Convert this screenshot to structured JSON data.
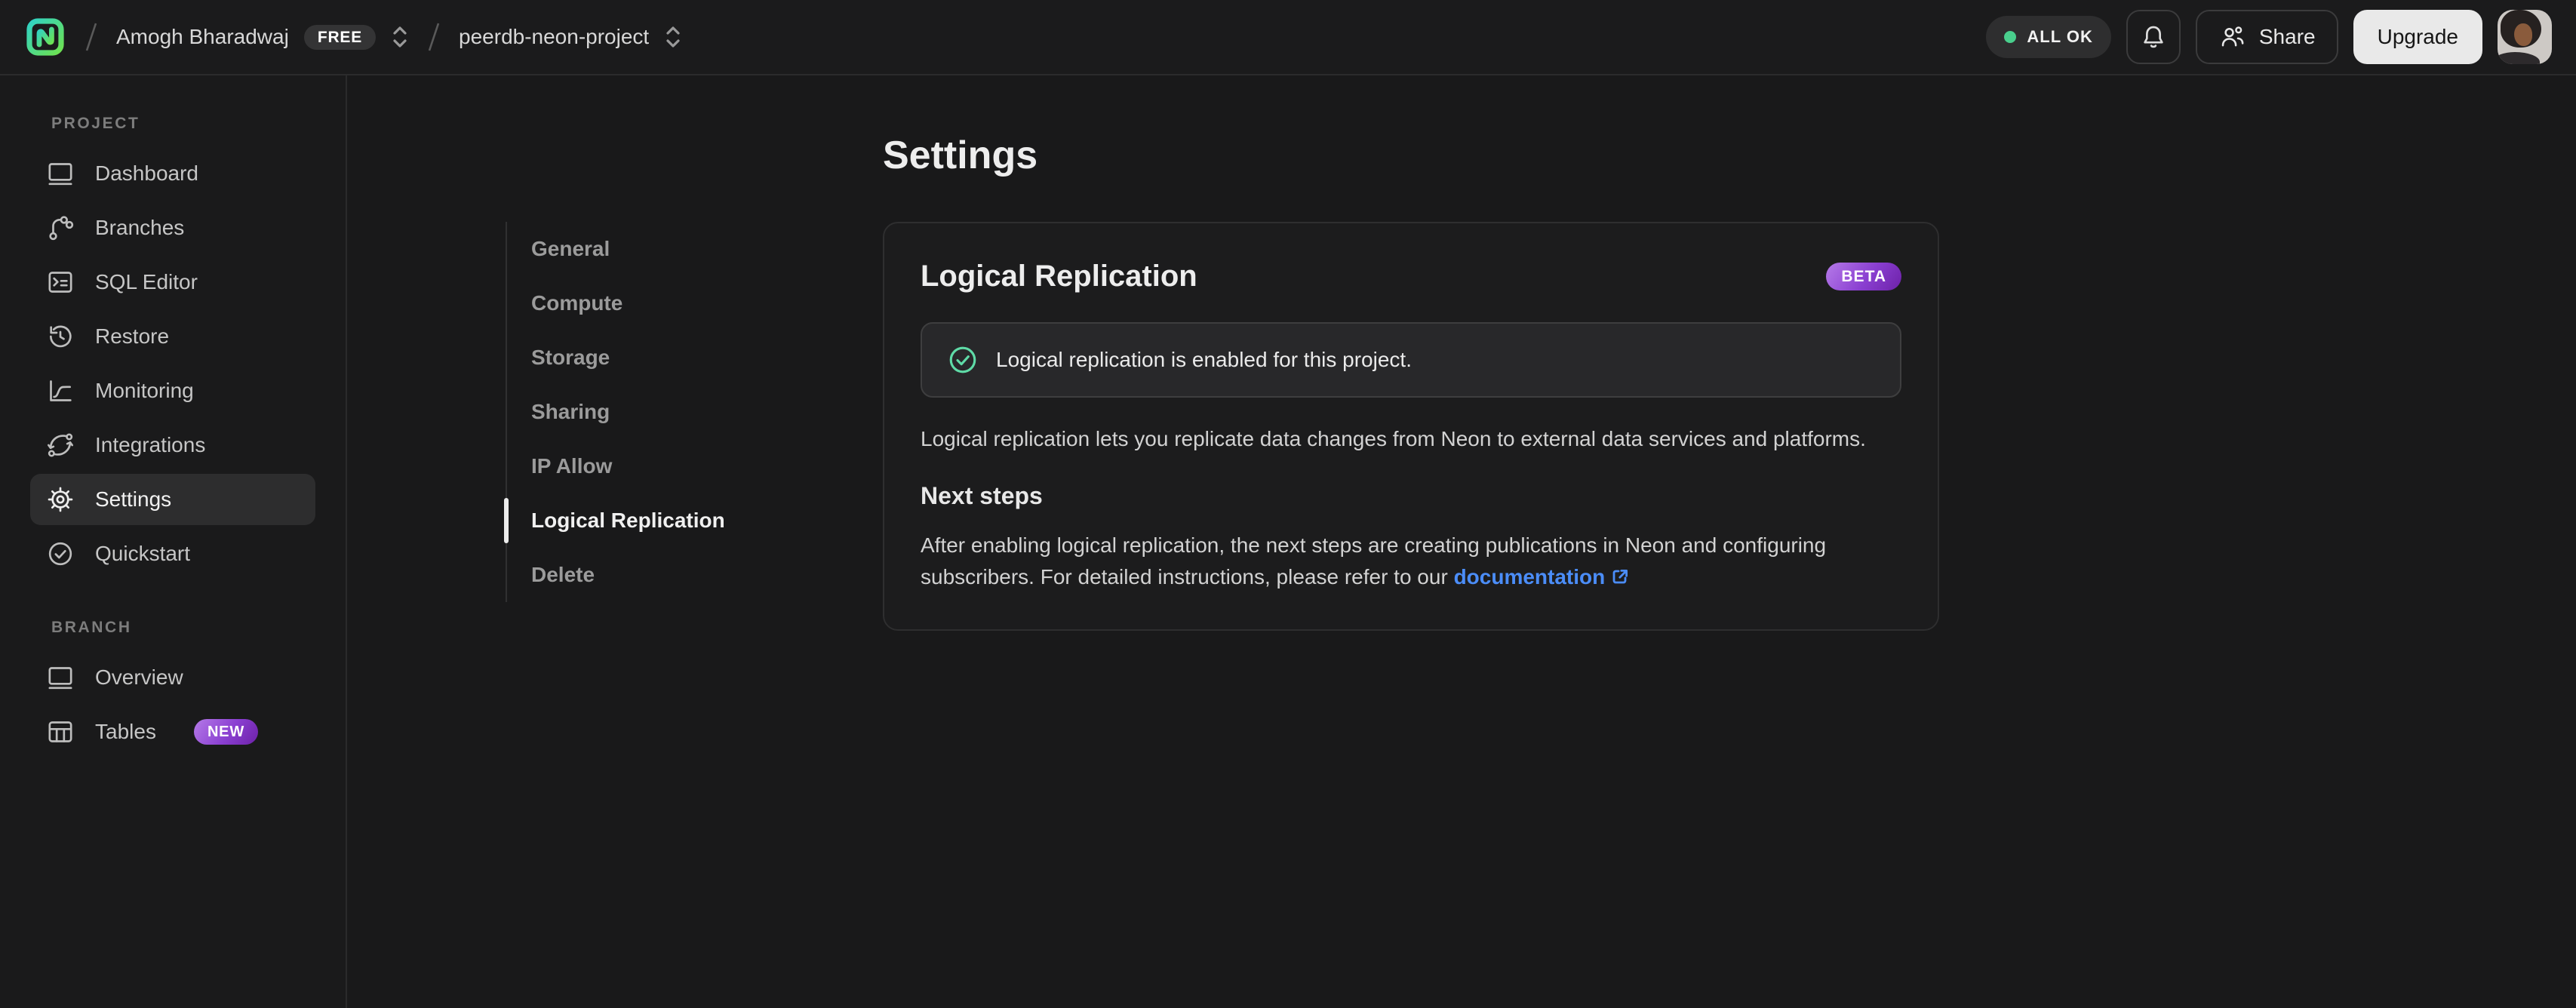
{
  "topbar": {
    "org_name": "Amogh Bharadwaj",
    "org_plan_badge": "FREE",
    "project_name": "peerdb-neon-project",
    "status_badge": "ALL OK",
    "share_label": "Share",
    "upgrade_label": "Upgrade"
  },
  "sidebar": {
    "sections": [
      {
        "label": "PROJECT",
        "items": [
          {
            "label": "Dashboard",
            "icon": "dashboard-icon"
          },
          {
            "label": "Branches",
            "icon": "branches-icon"
          },
          {
            "label": "SQL Editor",
            "icon": "sql-editor-icon"
          },
          {
            "label": "Restore",
            "icon": "restore-icon"
          },
          {
            "label": "Monitoring",
            "icon": "monitoring-icon"
          },
          {
            "label": "Integrations",
            "icon": "integrations-icon"
          },
          {
            "label": "Settings",
            "icon": "settings-gear-icon",
            "active": true
          },
          {
            "label": "Quickstart",
            "icon": "quickstart-check-icon"
          }
        ]
      },
      {
        "label": "BRANCH",
        "items": [
          {
            "label": "Overview",
            "icon": "overview-icon"
          },
          {
            "label": "Tables",
            "icon": "tables-icon",
            "badge": "NEW"
          }
        ]
      }
    ]
  },
  "settings_nav": {
    "items": [
      {
        "label": "General"
      },
      {
        "label": "Compute"
      },
      {
        "label": "Storage"
      },
      {
        "label": "Sharing"
      },
      {
        "label": "IP Allow"
      },
      {
        "label": "Logical Replication",
        "active": true
      },
      {
        "label": "Delete"
      }
    ]
  },
  "main": {
    "page_title": "Settings",
    "card": {
      "title": "Logical Replication",
      "beta_badge": "BETA",
      "banner_text": "Logical replication is enabled for this project.",
      "description": "Logical replication lets you replicate data changes from Neon to external data services and platforms.",
      "next_steps_title": "Next steps",
      "next_steps_text": "After enabling logical replication, the next steps are creating publications in Neon and configuring subscribers. For detailed instructions, please refer to our",
      "doc_link_label": "documentation"
    }
  },
  "colors": {
    "accent_green": "#63e24f",
    "accent_teal": "#30d2c4",
    "status_green": "#49cf8d",
    "badge_purple": "#8a3fd1",
    "link_blue": "#4b8df8"
  }
}
